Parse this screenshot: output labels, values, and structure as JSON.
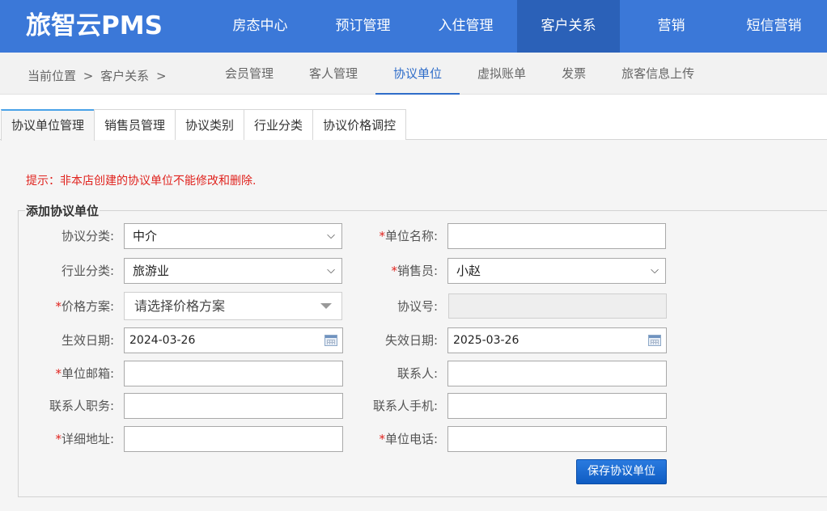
{
  "brand": "旅智云PMS",
  "nav": [
    "房态中心",
    "预订管理",
    "入住管理",
    "客户关系",
    "营销",
    "短信营销"
  ],
  "nav_active": 3,
  "breadcrumb": {
    "prefix": "当前位置",
    "sep": ">",
    "current": "客户关系",
    "sep2": ">"
  },
  "subtabs": [
    "会员管理",
    "客人管理",
    "协议单位",
    "虚拟账单",
    "发票",
    "旅客信息上传"
  ],
  "subtab_active": 2,
  "tabs": [
    "协议单位管理",
    "销售员管理",
    "协议类别",
    "行业分类",
    "协议价格调控"
  ],
  "tab_active": 0,
  "tip": "提示：非本店创建的协议单位不能修改和删除.",
  "form": {
    "legend": "添加协议单位",
    "required_mark": "*",
    "agreement_type": {
      "label": "协议分类:",
      "value": "中介"
    },
    "unit_name": {
      "label": "单位名称:",
      "value": ""
    },
    "industry": {
      "label": "行业分类:",
      "value": "旅游业"
    },
    "salesperson": {
      "label": "销售员:",
      "value": "小赵"
    },
    "price_plan": {
      "label": "价格方案:",
      "value": "请选择价格方案"
    },
    "agreement_no": {
      "label": "协议号:",
      "value": ""
    },
    "effective_date": {
      "label": "生效日期:",
      "value": "2024-03-26"
    },
    "expire_date": {
      "label": "失效日期:",
      "value": "2025-03-26"
    },
    "unit_email": {
      "label": "单位邮箱:",
      "value": ""
    },
    "contact": {
      "label": "联系人:",
      "value": ""
    },
    "contact_title": {
      "label": "联系人职务:",
      "value": ""
    },
    "contact_mobile": {
      "label": "联系人手机:",
      "value": ""
    },
    "address": {
      "label": "详细地址:",
      "value": ""
    },
    "unit_phone": {
      "label": "单位电话:",
      "value": ""
    },
    "save_label": "保存协议单位"
  }
}
